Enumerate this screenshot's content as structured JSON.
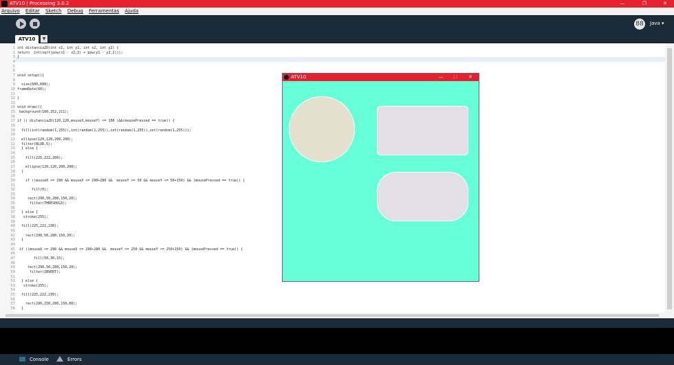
{
  "window": {
    "title": "ATV10 | Processing 3.0.2",
    "min": "—",
    "max": "❐",
    "close": "✕"
  },
  "menu": [
    "Arquivo",
    "Editar",
    "Sketch",
    "Debug",
    "Ferramentas",
    "Ajuda"
  ],
  "toolbar": {
    "mode_label": "Java ▾",
    "mode_icon": "88"
  },
  "tab": {
    "label": "ATV10",
    "menu_glyph": "▼"
  },
  "code": [
    "int distancia2D(int x1, int y1, int x2, int y2) {",
    "return  int(sqrt(pow(x1 - x2,2) + pow(y1 - y2,2)));",
    "}",
    "",
    "",
    "",
    "void setup(){",
    "",
    "  size(600,600);",
    "frameRate(60);",
    "",
    "}",
    "",
    "void draw(){",
    " background(100,252,211);",
    "",
    "if (( distancia2D(120,120,mouseX,mouseY) <= 100 )&&(mousePressed == true)) {",
    "",
    "  fill(int(random(1,255)),int(random(1,255)),int(random(1,255)),int(random(1,255)));",
    "",
    "  ellipse(120,120,200,200);",
    "  filter(BLUR,5);",
    "  } else {",
    "",
    "    fill(225,222,200);",
    "",
    "    ellipse(120,120,200,200);",
    "  }",
    "",
    "    if ((mouseX >= 290 && mouseX <= 290+280 &&  mouseY >= 50 && mouseY <= 50+150) && (mousePressed == true)) {",
    "",
    "       fill(0);",
    "",
    "     rect(290,50,280,150,20);",
    "      filter(THRESHOLD);",
    "",
    "  } else {",
    "   stroke(255);",
    "",
    "  fill(225,222,230);",
    "",
    "    rect(290,50,280,150,20);",
    "  }",
    "",
    " if ((mouseX >= 290 && mouseX <= 290+280 &&  mouseY >= 250 && mouseY <= 250+150) && (mousePressed == true)) {",
    "",
    "        fill(50,30,15);",
    "",
    "     rect(290,50,280,150,20);",
    "      filter(INVERT);",
    "",
    "  } else {",
    "   stroke(255);",
    "",
    "  fill(225,222,230);",
    "",
    "    rect(290,250,280,150,80);",
    "  }"
  ],
  "bottom_tabs": {
    "console": "Console",
    "errors": "Errors"
  },
  "sketch_window": {
    "title": "ATV10",
    "min": "—",
    "max": "☐",
    "close": "✕"
  },
  "colors": {
    "accent": "#e5202f",
    "sketch_bg": "#66ffd7",
    "ellipse": "#e3e0cd",
    "rect": "#e2e0e6"
  }
}
